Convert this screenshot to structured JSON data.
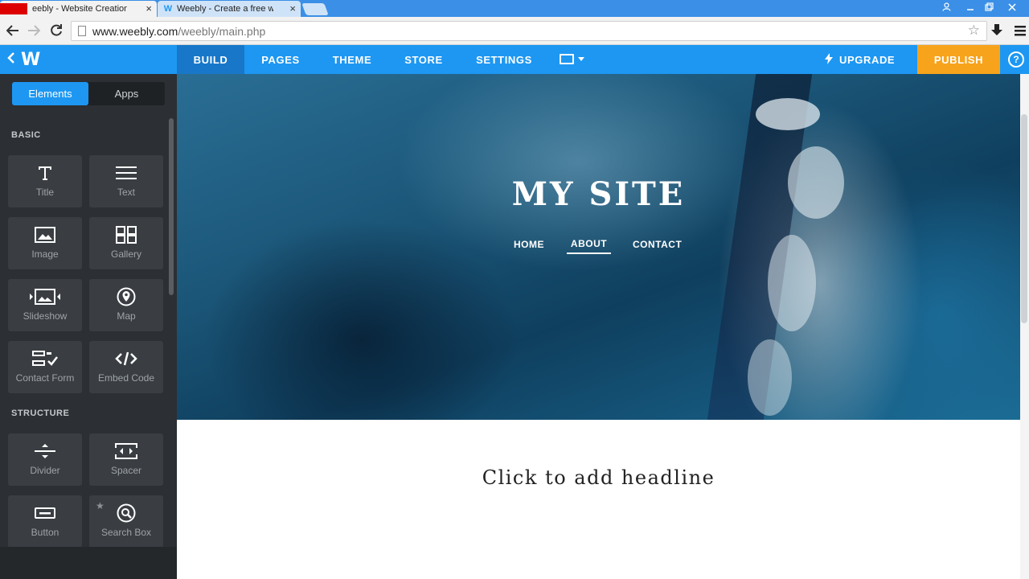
{
  "browser": {
    "tabs": [
      {
        "label": "eebly - Website Creation",
        "close": "×"
      },
      {
        "label": "Weebly - Create a free we",
        "close": "×"
      }
    ],
    "url_host": "www.weebly.com",
    "url_path": "/weebly/main.php"
  },
  "topbar": {
    "logo": "W",
    "nav": [
      {
        "label": "BUILD"
      },
      {
        "label": "PAGES"
      },
      {
        "label": "THEME"
      },
      {
        "label": "STORE"
      },
      {
        "label": "SETTINGS"
      }
    ],
    "upgrade": "UPGRADE",
    "publish": "PUBLISH",
    "help": "?"
  },
  "sidebar": {
    "tabs": {
      "elements": "Elements",
      "apps": "Apps"
    },
    "sections": {
      "basic": "BASIC",
      "structure": "STRUCTURE"
    },
    "basic_items": [
      {
        "label": "Title",
        "icon": "title-icon"
      },
      {
        "label": "Text",
        "icon": "text-icon"
      },
      {
        "label": "Image",
        "icon": "image-icon"
      },
      {
        "label": "Gallery",
        "icon": "gallery-icon"
      },
      {
        "label": "Slideshow",
        "icon": "slideshow-icon"
      },
      {
        "label": "Map",
        "icon": "map-pin-icon"
      },
      {
        "label": "Contact Form",
        "icon": "contact-form-icon"
      },
      {
        "label": "Embed Code",
        "icon": "code-icon"
      }
    ],
    "structure_items": [
      {
        "label": "Divider",
        "icon": "divider-icon"
      },
      {
        "label": "Spacer",
        "icon": "spacer-icon"
      },
      {
        "label": "Button",
        "icon": "button-icon"
      },
      {
        "label": "Search Box",
        "icon": "search-icon"
      }
    ]
  },
  "site": {
    "title": "MY SITE",
    "nav": [
      "HOME",
      "ABOUT",
      "CONTACT"
    ],
    "headline_placeholder": "Click to add headline"
  },
  "colors": {
    "topbar": "#1d97f2",
    "build_active": "#1877c8",
    "publish": "#f7a31c",
    "sidebar": "#2c2f33",
    "tile": "#3a3e43"
  }
}
